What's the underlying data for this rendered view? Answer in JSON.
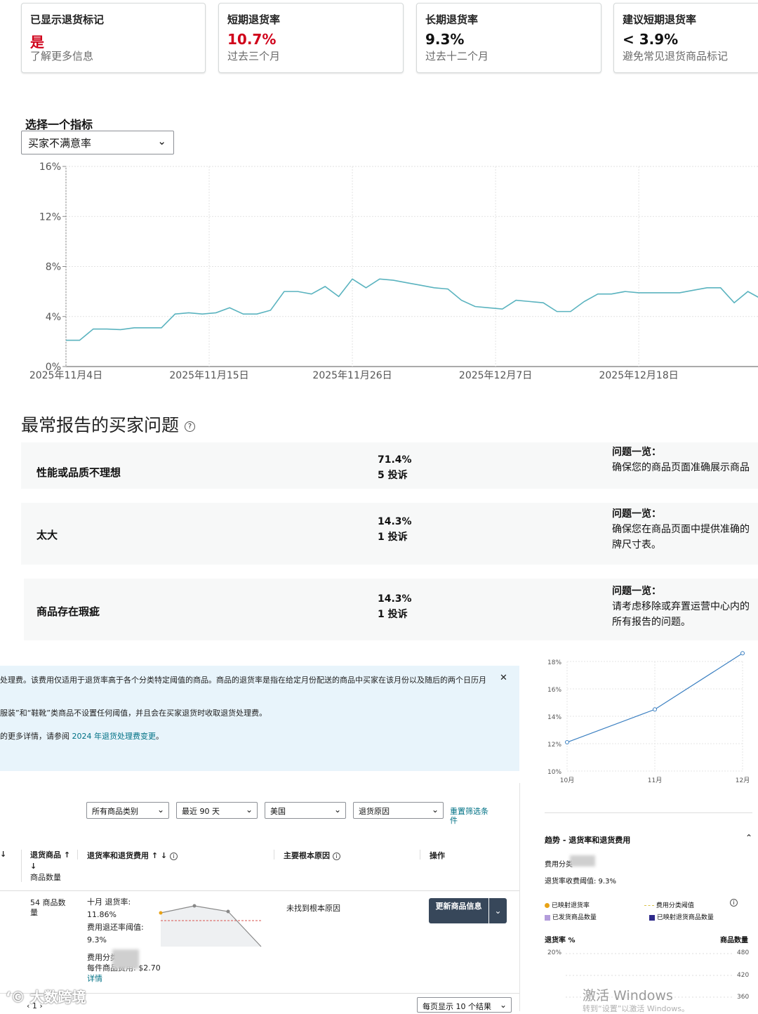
{
  "cards": [
    {
      "title": "已显示退货标记",
      "value": "是",
      "sub": "了解更多信息"
    },
    {
      "title": "短期退货率",
      "value": "10.7%",
      "sub": "过去三个月"
    },
    {
      "title": "长期退货率",
      "value": "9.3%",
      "sub": "过去十二个月"
    },
    {
      "title": "建议短期退货率",
      "value": "< 3.9%",
      "sub": "避免常见退货商品标记"
    }
  ],
  "metric": {
    "label": "选择一个指标",
    "selected": "买家不满意率"
  },
  "chart_data": [
    {
      "type": "line",
      "y_ticks": [
        "16%",
        "12%",
        "8%",
        "4%",
        "0%"
      ],
      "x_ticks": [
        "2025年11月4日",
        "2025年11月15日",
        "2025年11月26日",
        "2025年12月7日",
        "2025年12月18日"
      ],
      "ylim": [
        0,
        16
      ],
      "xlim": [
        0,
        51
      ],
      "grid": true,
      "series": [
        {
          "x": [
            0,
            1,
            2,
            3,
            4,
            5,
            6,
            7,
            8,
            9,
            10,
            11,
            12,
            13,
            14,
            15,
            16,
            17,
            18,
            19,
            20,
            21,
            22,
            23,
            24,
            25,
            26,
            27,
            28,
            29,
            30,
            31,
            32,
            33,
            34,
            35,
            36,
            37,
            38,
            39,
            40,
            41,
            42,
            43,
            44,
            45,
            46,
            47,
            48,
            49,
            50,
            51
          ],
          "values": [
            2.1,
            2.1,
            3.0,
            3.0,
            2.95,
            3.1,
            3.1,
            3.1,
            4.2,
            4.3,
            4.2,
            4.3,
            4.7,
            4.2,
            4.2,
            4.5,
            6.0,
            6.0,
            5.8,
            6.4,
            5.6,
            7.0,
            6.3,
            7.0,
            6.9,
            6.7,
            6.5,
            6.3,
            6.2,
            5.3,
            4.8,
            4.7,
            4.6,
            5.3,
            5.2,
            5.1,
            4.4,
            4.4,
            5.2,
            5.8,
            5.8,
            6.0,
            5.9,
            5.9,
            5.9,
            5.9,
            6.1,
            6.3,
            6.3,
            5.1,
            6.0,
            5.4
          ],
          "color": "#5ab3bf"
        }
      ]
    },
    {
      "type": "line",
      "y_ticks": [
        "18%",
        "16%",
        "14%",
        "12%",
        "10%"
      ],
      "x_ticks": [
        "10月",
        "11月",
        "12月"
      ],
      "ylim": [
        10,
        18
      ],
      "grid": true,
      "series": [
        {
          "x": [
            0,
            1,
            2
          ],
          "values": [
            12.1,
            14.5,
            18.6
          ],
          "color": "#3a7fc1"
        }
      ]
    }
  ],
  "issues_title": "最常报告的买家问题",
  "issues": [
    {
      "name": "性能或品质不理想",
      "pct": "71.4%",
      "count": "5 投诉",
      "ov_title": "问题一览：",
      "ov_lines": [
        "确保您的商品页面准确展示商品"
      ]
    },
    {
      "name": "太大",
      "pct": "14.3%",
      "count": "1 投诉",
      "ov_title": "问题一览：",
      "ov_lines": [
        "确保您在商品页面中提供准确的",
        "牌尺寸表。"
      ]
    },
    {
      "name": "商品存在瑕疵",
      "pct": "14.3%",
      "count": "1 投诉",
      "ov_title": "问题一览：",
      "ov_lines": [
        "请考虑移除或弃置运营中心内的",
        "所有报告的问题。"
      ]
    }
  ],
  "notice": {
    "line1": "处理费。该费用仅适用于退货率高于各个分类特定阈值的商品。商品的退货率是指在给定月份配送的商品中买家在该月份以及随后的两个日历月",
    "line2": "服装”和“鞋靴”类商品不设置任何阈值，并且会在买家退货时收取退货处理费。",
    "line3_prefix": "的更多详情，请参阅",
    "line3_link": "2024 年退货处理费变更",
    "line3_suffix": "。",
    "close": "✕"
  },
  "filters": {
    "category": "所有商品类别",
    "period": "最近 90 天",
    "country": "美国",
    "reason": "退货原因",
    "reset": "重置筛选条件"
  },
  "table": {
    "col_returned": "退货商品",
    "col_sort": "↑ ↓",
    "col_units": "商品数量",
    "col_rate": "退货率和退货费用",
    "col_rate_sort": "↑ ↓",
    "col_cause": "主要根本原因",
    "col_action": "操作",
    "row": {
      "units": "54 商品数量",
      "oct_rate_label": "十月 退货率:",
      "oct_rate": "11.86%",
      "threshold_label": "费用退还率阈值:",
      "threshold": "9.3%",
      "fee_cat_label": "费用分类",
      "fee_per_item_label": "每件商品费用:",
      "fee_per_item": "$2.70",
      "details": "详情",
      "cause": "未找到根本原因",
      "action": "更新商品信息"
    },
    "page": "1",
    "per_page": "每页显示 10 个结果"
  },
  "trend": {
    "title": "趋势 - 退货率和退货费用",
    "fee_cat_label": "费用分类",
    "threshold": "退货率收费阈值: 9.3%",
    "legend": [
      "已映射退货率",
      "费用分类阈值",
      "已发货商品数量",
      "已映射退货商品数量"
    ],
    "legend_colors": [
      "#e8a317",
      "#d9c24a",
      "#b39ddb",
      "#2e2a8a"
    ],
    "left_axis": "退货率 %",
    "right_axis": "商品数量",
    "left_ticks": [
      "20%"
    ],
    "right_ticks": [
      "480",
      "420",
      "360"
    ]
  },
  "watermark": "大数跨境",
  "activate": {
    "line1": "激活 Windows",
    "line2": "转到“设置”以激活 Windows。"
  }
}
